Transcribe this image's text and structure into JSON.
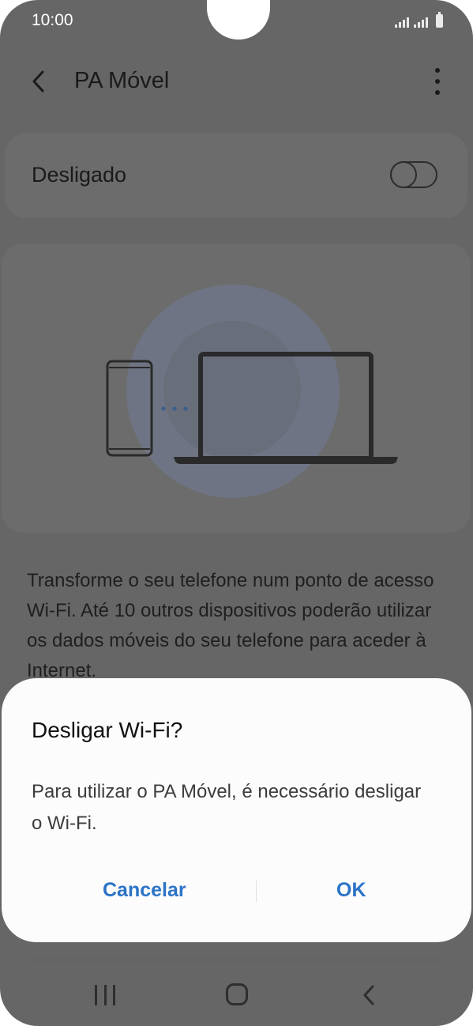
{
  "status_bar": {
    "time": "10:00"
  },
  "header": {
    "title": "PA Móvel"
  },
  "switch": {
    "label": "Desligado",
    "state": "off"
  },
  "description": "Transforme o seu telefone num ponto de acesso Wi-Fi. Até 10 outros dispositivos poderão utilizar os dados móveis do seu telefone para aceder à Internet.",
  "dialog": {
    "title": "Desligar Wi-Fi?",
    "message": "Para utilizar o PA Móvel, é necessário desligar o Wi-Fi.",
    "cancel_label": "Cancelar",
    "ok_label": "OK"
  },
  "icons": {
    "back": "back-arrow-icon",
    "more": "more-options-icon",
    "nav_recents": "recents-icon",
    "nav_home": "home-icon",
    "nav_back": "nav-back-icon"
  },
  "colors": {
    "dim_background": "#666666",
    "dialog_background": "#fcfcfc",
    "button_accent": "#2b73c7",
    "illustration_glow": "#6e7483"
  }
}
